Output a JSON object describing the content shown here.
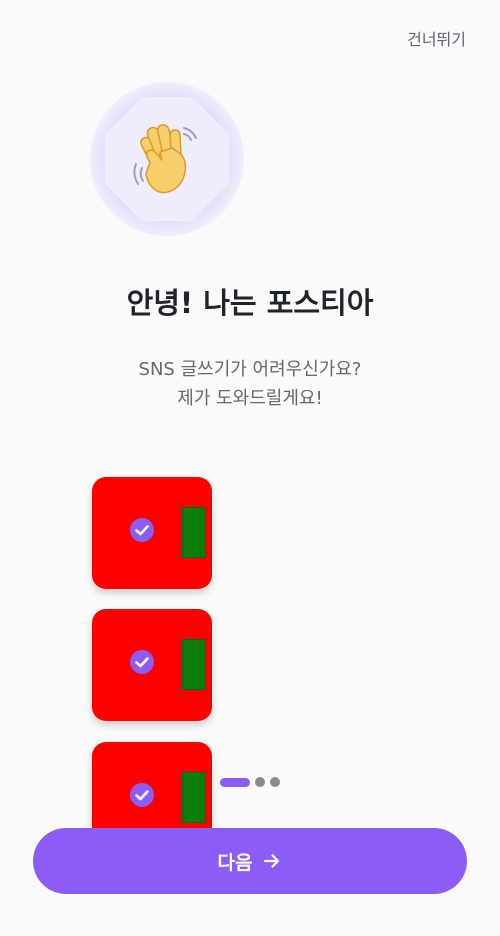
{
  "header": {
    "skip_label": "건너뛰기"
  },
  "hero": {
    "icon": "waving-hand-icon",
    "title": "안녕! 나는 포스티아",
    "subtitle_line1": "SNS 글쓰기가 어려우신가요?",
    "subtitle_line2": "제가 도와드릴게요!"
  },
  "feature_cards": [
    {
      "icon": "check-circle-icon",
      "color": "#ff0000"
    },
    {
      "icon": "check-circle-icon",
      "color": "#ff0000"
    },
    {
      "icon": "check-circle-icon",
      "color": "#ff0000"
    }
  ],
  "pager": {
    "total_pages": 3,
    "current_page": 1
  },
  "footer": {
    "next_label": "다음",
    "next_icon": "arrow-right-icon"
  },
  "colors": {
    "accent": "#8b5cf6",
    "card": "#ff0000",
    "card_block": "#0a7d0a",
    "background": "#fafafa"
  }
}
